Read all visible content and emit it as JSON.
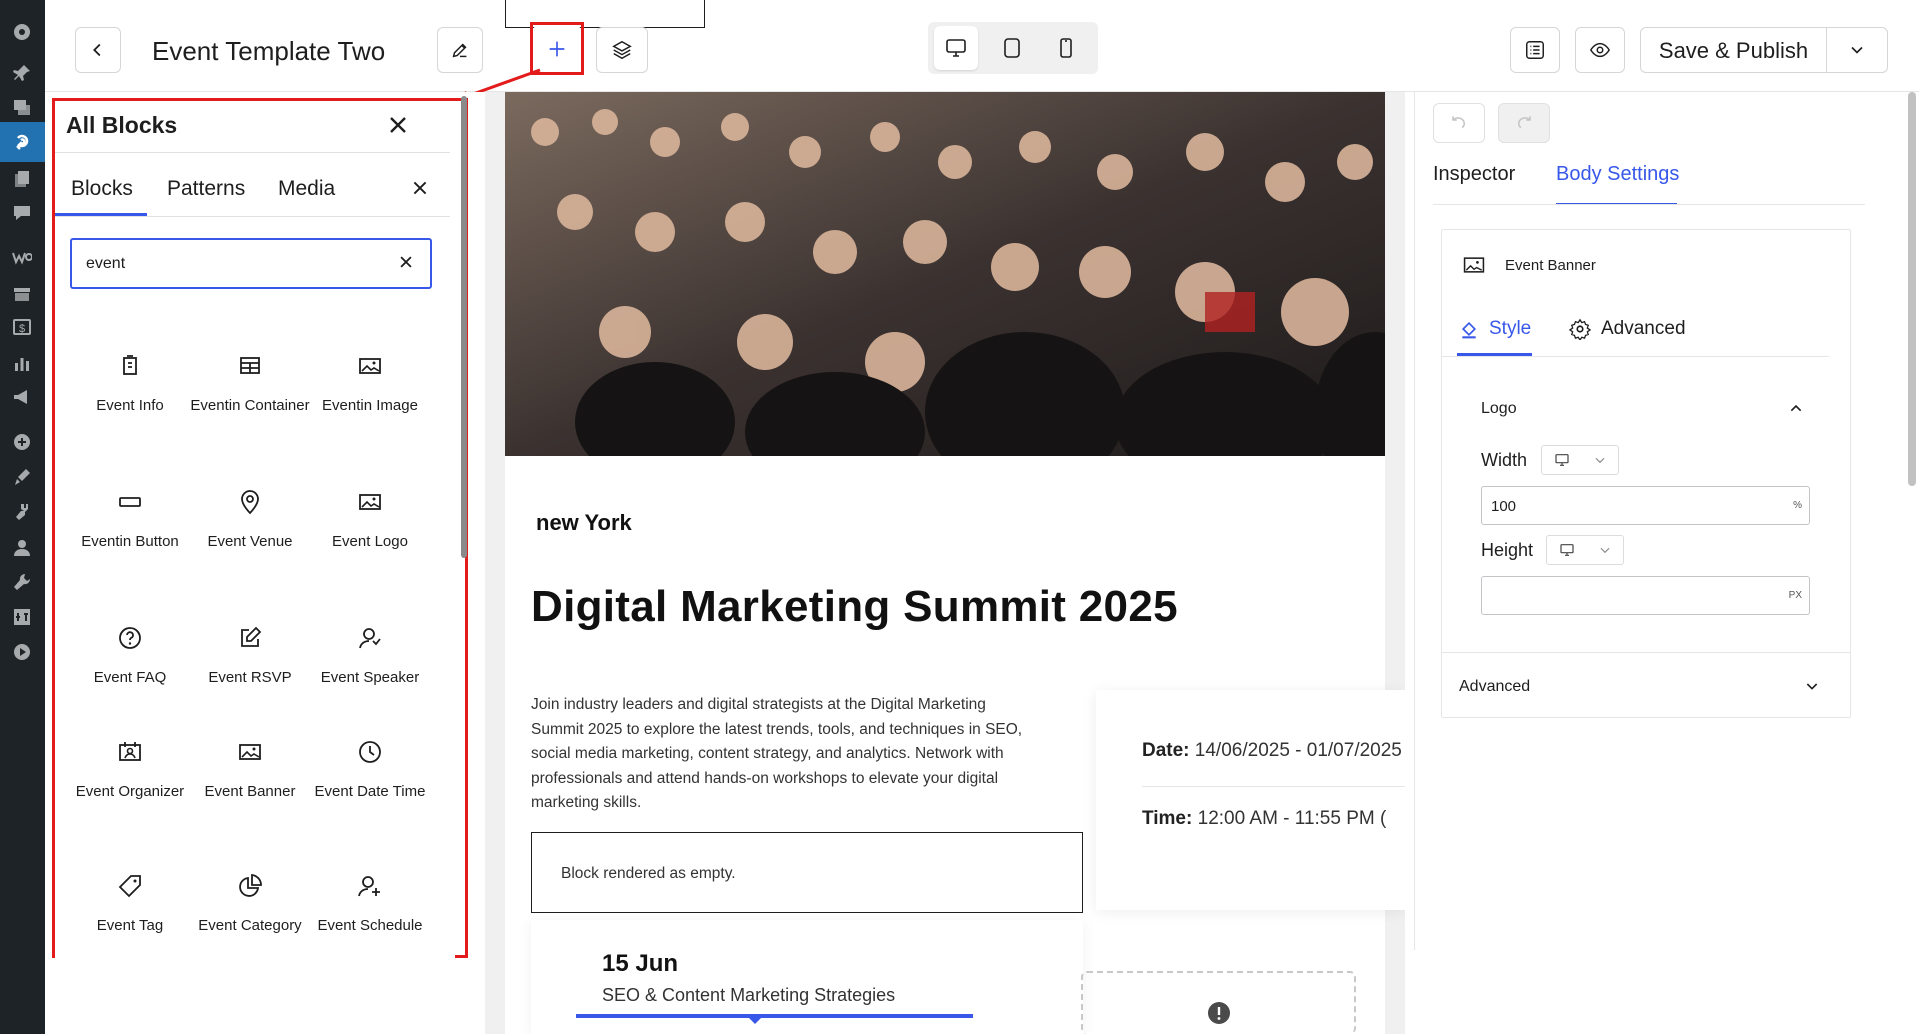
{
  "wp_menu": [
    "dashboard-icon",
    "pin-icon",
    "media-icon",
    "eventin-icon",
    "pages-icon",
    "comments-icon",
    "woo-icon",
    "products-icon",
    "payments-icon",
    "analytics-icon",
    "marketing-icon",
    "plus-circle-icon",
    "appearance-icon",
    "plugins-icon",
    "users-icon",
    "tools-icon",
    "settings-icon",
    "play-icon"
  ],
  "header": {
    "title": "Event Template Two",
    "publish_label": "Save & Publish"
  },
  "inserter": {
    "title": "All Blocks",
    "tabs": [
      "Blocks",
      "Patterns",
      "Media"
    ],
    "search_value": "event",
    "blocks": [
      {
        "label": "Event Info",
        "icon": "event-info-icon"
      },
      {
        "label": "Eventin Container",
        "icon": "container-icon"
      },
      {
        "label": "Eventin Image",
        "icon": "image-icon"
      },
      {
        "label": "Eventin Button",
        "icon": "button-icon"
      },
      {
        "label": "Event Venue",
        "icon": "location-pin-icon"
      },
      {
        "label": "Event Logo",
        "icon": "logo-image-icon"
      },
      {
        "label": "Event FAQ",
        "icon": "question-icon"
      },
      {
        "label": "Event RSVP",
        "icon": "edit-icon"
      },
      {
        "label": "Event Speaker",
        "icon": "speaker-icon"
      },
      {
        "label": "Event Organizer",
        "icon": "organizer-icon"
      },
      {
        "label": "Event Banner",
        "icon": "banner-image-icon"
      },
      {
        "label": "Event Date Time",
        "icon": "clock-icon"
      },
      {
        "label": "Event Tag",
        "icon": "tag-icon"
      },
      {
        "label": "Event Category",
        "icon": "pie-chart-icon"
      },
      {
        "label": "Event Schedule",
        "icon": "schedule-icon"
      }
    ]
  },
  "canvas": {
    "city": "new York",
    "heading": "Digital Marketing Summit 2025",
    "description": "Join industry leaders and digital strategists at the Digital Marketing Summit 2025 to explore the latest trends, tools, and techniques in SEO, social media marketing, content strategy, and analytics. Network with professionals and attend hands-on workshops to elevate your digital marketing skills.",
    "date_label": "Date:",
    "date_value": "14/06/2025 - 01/07/2025",
    "time_label": "Time:",
    "time_value": "12:00 AM - 11:55 PM (",
    "empty_notice": "Block rendered as empty.",
    "schedule_date": "15 Jun",
    "schedule_title": "SEO & Content Marketing Strategies"
  },
  "settings": {
    "tabs": [
      "Inspector",
      "Body Settings"
    ],
    "block_name": "Event Banner",
    "subtabs": [
      "Style",
      "Advanced"
    ],
    "section": "Logo",
    "width_label": "Width",
    "width_value": "100",
    "width_unit": "%",
    "height_label": "Height",
    "height_value": "",
    "height_unit": "PX",
    "advanced_label": "Advanced"
  },
  "colors": {
    "accent": "#3858e9",
    "highlight": "#e31b1b",
    "admin_bar": "#1d2327"
  }
}
